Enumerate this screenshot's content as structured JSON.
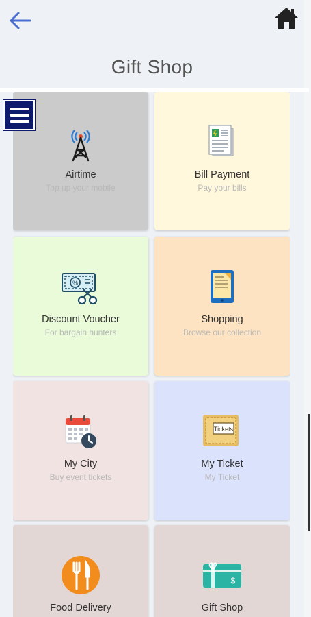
{
  "header": {
    "title": "Gift Shop",
    "back_icon": "arrow-left-icon",
    "home_icon": "home-icon"
  },
  "colors": {
    "accent": "#4b6fd1",
    "menu": "#0e1a6b"
  },
  "tiles": [
    {
      "title": "Airtime",
      "subtitle": "Top up your mobile",
      "icon": "antenna-tower-icon",
      "bg": "#cbcbcb"
    },
    {
      "title": "Bill Payment",
      "subtitle": "Pay your bills",
      "icon": "bill-document-icon",
      "bg": "#fff8dd"
    },
    {
      "title": "Discount Voucher",
      "subtitle": "For bargain hunters",
      "icon": "voucher-scissors-icon",
      "bg": "#e9fbd8"
    },
    {
      "title": "Shopping",
      "subtitle": "Browse our collection",
      "icon": "tablet-shopping-icon",
      "bg": "#fde3c2"
    },
    {
      "title": "My City",
      "subtitle": "Buy event tickets",
      "icon": "calendar-clock-icon",
      "bg": "#f1e3e1"
    },
    {
      "title": "My Ticket",
      "subtitle": "My Ticket",
      "icon": "ticket-icon",
      "bg": "#dbe3fc"
    },
    {
      "title": "Food Delivery",
      "subtitle": "",
      "icon": "fork-knife-icon",
      "bg": "#e2d7d5"
    },
    {
      "title": "Gift Shop",
      "subtitle": "",
      "icon": "gift-card-icon",
      "bg": "#e2d7d5"
    }
  ],
  "ticket_label": "Tickets"
}
